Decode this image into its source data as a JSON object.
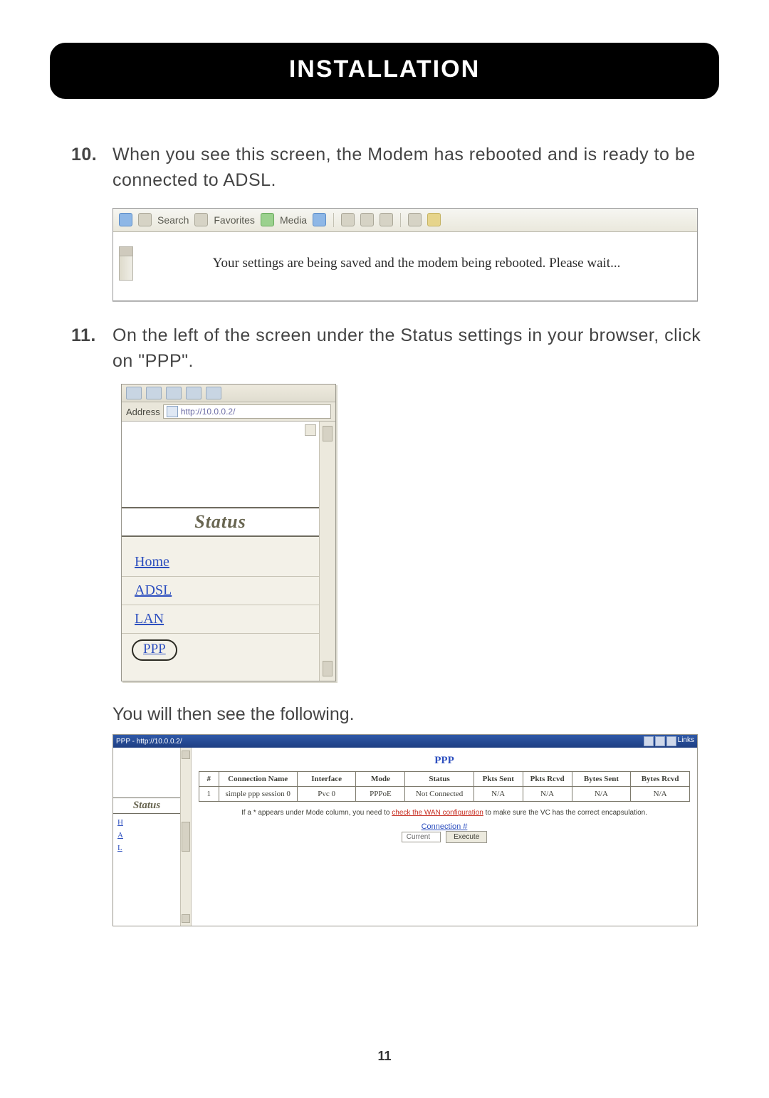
{
  "header": {
    "title": "INSTALLATION"
  },
  "steps": {
    "s10": {
      "num": "10.",
      "text": "When you see this screen, the Modem has rebooted and is ready to be connected to ADSL."
    },
    "s11": {
      "num": "11.",
      "text": "On the left of the screen under the Status settings in your browser, click on \"PPP\"."
    }
  },
  "continuation": "You will then see the following.",
  "shot1": {
    "toolbar": {
      "search": "Search",
      "favorites": "Favorites",
      "media": "Media"
    },
    "message": "Your settings are being saved and the modem being rebooted. Please wait..."
  },
  "shot2": {
    "address_label": "Address",
    "address_value": "http://10.0.0.2/",
    "status_heading": "Status",
    "nav": {
      "home": "Home",
      "adsl": "ADSL",
      "lan": "LAN",
      "ppp": "PPP"
    }
  },
  "shot3": {
    "titlebar_left": "PPP - http://10.0.0.2/",
    "titlebar_right": "Links",
    "nav_status": "Status",
    "nav_links": {
      "h": "H",
      "a": "A",
      "l": "L"
    },
    "footer_left": "",
    "ppp_title": "PPP",
    "headers": {
      "n": "#",
      "conn": "Connection Name",
      "iface": "Interface",
      "mode": "Mode",
      "status": "Status",
      "pkts_sent": "Pkts Sent",
      "pkts_rcvd": "Pkts Rcvd",
      "bytes_sent": "Bytes Sent",
      "bytes_rcvd": "Bytes Rcvd"
    },
    "row1": {
      "n": "1",
      "conn": "simple ppp session 0",
      "iface": "Pvc 0",
      "mode": "PPPoE",
      "status": "Not Connected",
      "pkts_sent": "N/A",
      "pkts_rcvd": "N/A",
      "bytes_sent": "N/A",
      "bytes_rcvd": "N/A"
    },
    "footnote_pre": "If a * appears under Mode column, you need to ",
    "footnote_link": "check the WAN configuration",
    "footnote_post": " to make sure the VC has the correct encapsulation.",
    "connection_label": "Connection #",
    "select_value": "Current",
    "execute_btn": "Execute"
  },
  "page_number": "11"
}
